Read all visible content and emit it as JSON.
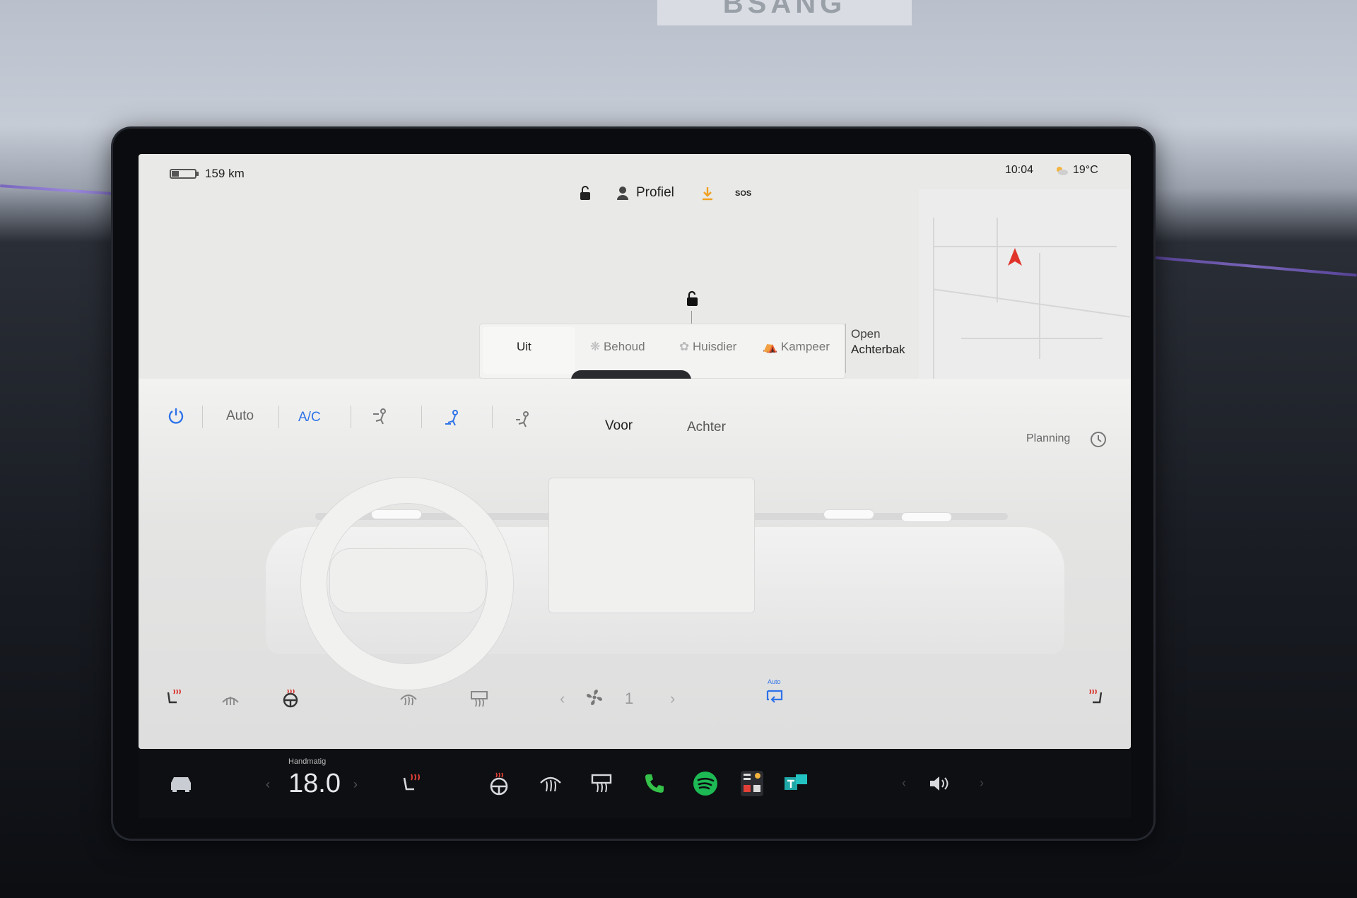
{
  "status_bar": {
    "range": "159 km",
    "profile": "Profiel",
    "sos": "SOS",
    "time": "10:04",
    "temperature": "19°C"
  },
  "trunk": {
    "line1": "Open",
    "line2": "Achterbak"
  },
  "climate_modes": [
    "Uit",
    "Behoud",
    "Huisdier",
    "Kampeer"
  ],
  "climate_controls": {
    "auto": "Auto",
    "ac": "A/C",
    "front": "Voor",
    "rear": "Achter",
    "planning": "Planning",
    "fan_speed": "1",
    "recirc_label": "Auto"
  },
  "taskbar": {
    "temp_mode": "Handmatig",
    "temperature": "18.0"
  },
  "colors": {
    "accent_blue": "#2f73e8",
    "heat_red": "#d9312b",
    "phone_green": "#34c24a",
    "spotify_green": "#1db954",
    "download_orange": "#f0a020",
    "nav_arrow": "#e0342a"
  },
  "icons": {
    "battery": "battery-icon",
    "lock": "lock-open-icon",
    "person": "person-icon",
    "download": "download-icon",
    "weather": "partly-cloudy-icon",
    "power": "power-icon",
    "clock": "clock-icon",
    "car": "car-icon",
    "volume": "volume-icon",
    "phone": "phone-icon",
    "spotify": "spotify-icon"
  }
}
